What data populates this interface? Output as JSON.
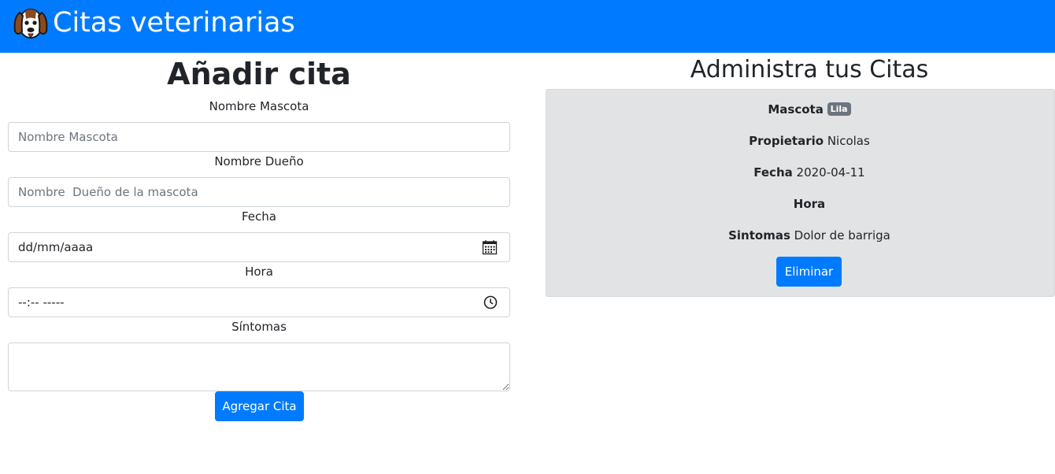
{
  "header": {
    "title": "Citas veterinarias",
    "logo_icon": "dog-icon",
    "bg_color": "#007bff"
  },
  "form": {
    "title": "Añadir cita",
    "pet_label": "Nombre Mascota",
    "pet_placeholder": "Nombre Mascota",
    "owner_label": "Nombre Dueño",
    "owner_placeholder": "Nombre  Dueño de la mascota",
    "date_label": "Fecha",
    "date_value": "dd/mm/aaaa",
    "date_icon": "calendar-icon",
    "time_label": "Hora",
    "time_value": "--:-- -----",
    "time_icon": "clock-icon",
    "symptoms_label": "Síntomas",
    "symptoms_value": "",
    "submit_label": "Agregar Cita"
  },
  "admin": {
    "title": "Administra tus Citas",
    "appointments": [
      {
        "pet_label": "Mascota",
        "pet_value": "Lila",
        "owner_label": "Propietario",
        "owner_value": "Nicolas",
        "date_label": "Fecha",
        "date_value": "2020-04-11",
        "time_label": "Hora",
        "time_value": "",
        "symptoms_label": "Sintomas",
        "symptoms_value": "Dolor de barriga",
        "delete_label": "Eliminar"
      }
    ]
  },
  "colors": {
    "accent": "#007bff",
    "card_bg": "#e2e3e5",
    "badge_bg": "#6c757d"
  }
}
